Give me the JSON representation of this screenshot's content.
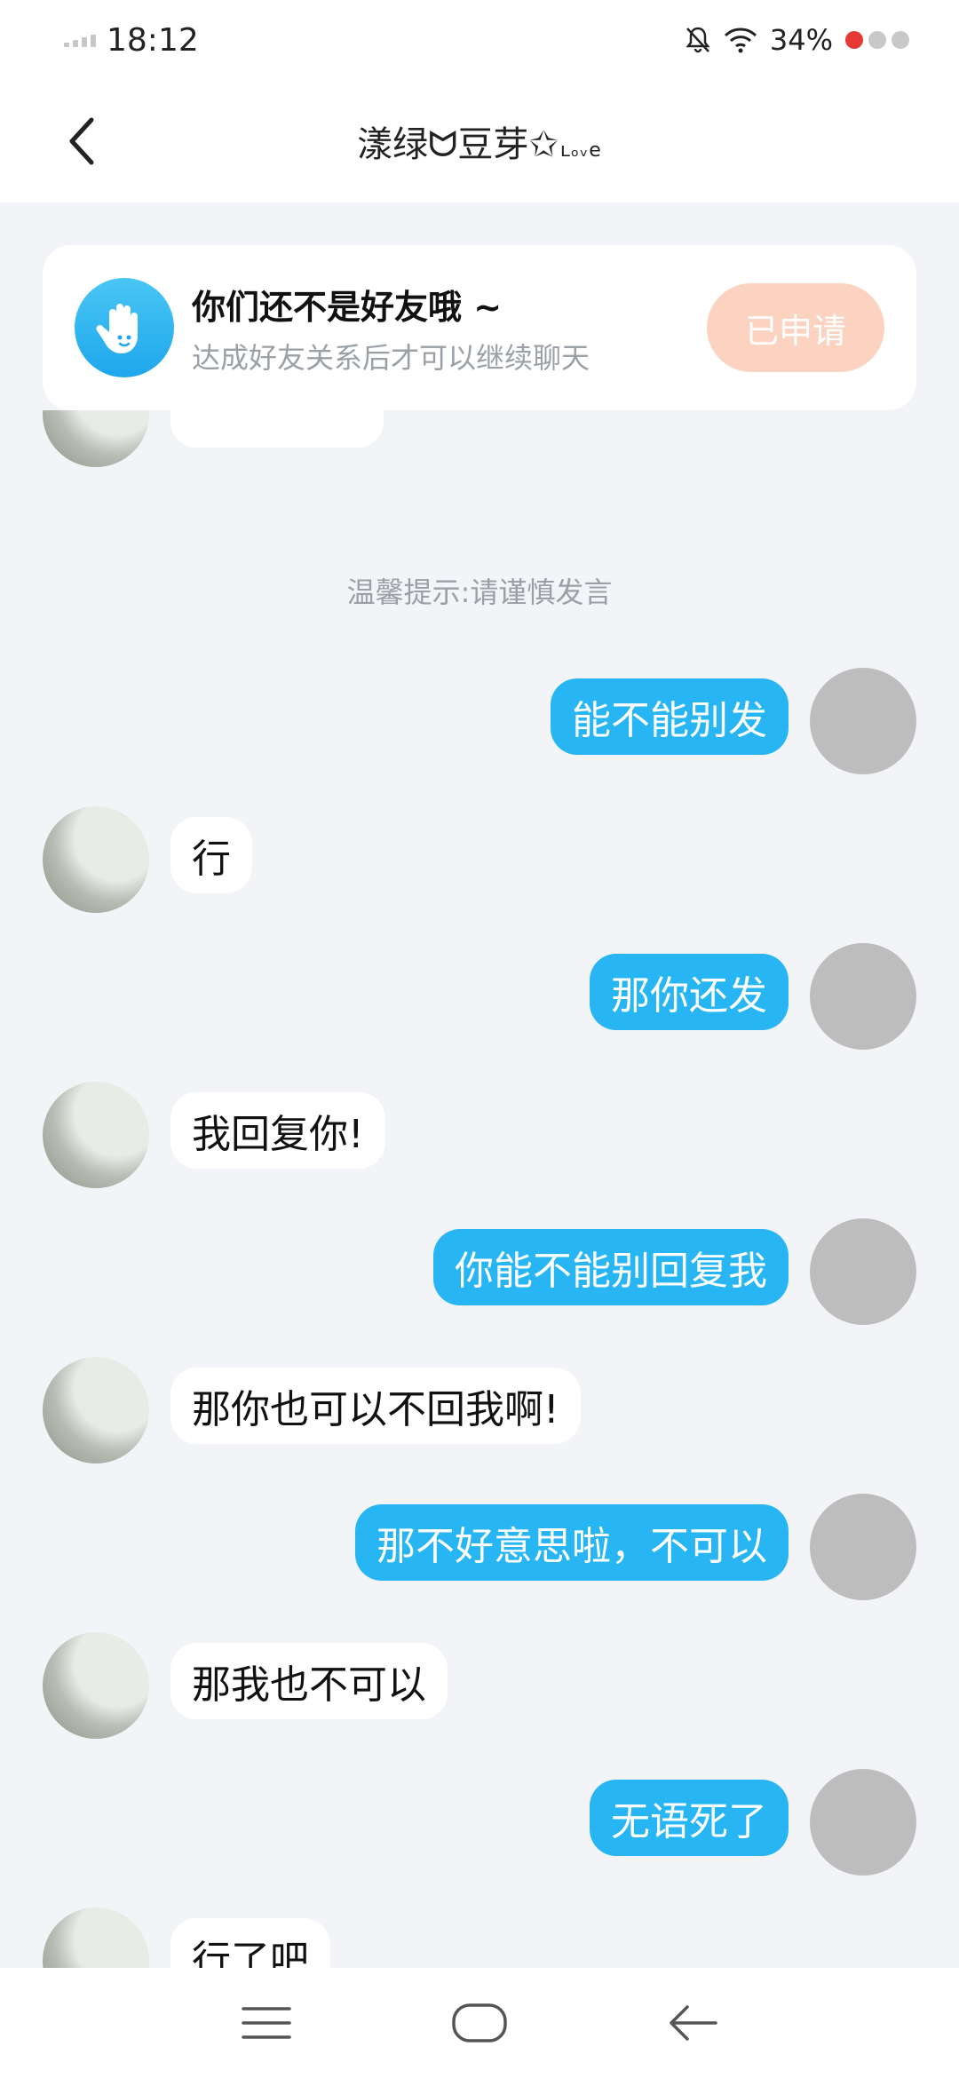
{
  "status_bar": {
    "time": "18:12",
    "battery": "34%"
  },
  "header": {
    "title": "漾绿ᗢ豆芽✩",
    "title_suffix": "ʟₒᵥe"
  },
  "notice": {
    "title": "你们还不是好友哦 ~",
    "subtitle": "达成好友关系后才可以继续聊天",
    "button_label": "已申请"
  },
  "chat": {
    "tip": "温馨提示:请谨慎发言",
    "messages": [
      {
        "from": "me",
        "text": "能不能别发"
      },
      {
        "from": "other",
        "text": "行"
      },
      {
        "from": "me",
        "text": "那你还发"
      },
      {
        "from": "other",
        "text": "我回复你!"
      },
      {
        "from": "me",
        "text": "你能不能别回复我"
      },
      {
        "from": "other",
        "text": "那你也可以不回我啊!"
      },
      {
        "from": "me",
        "text": "那不好意思啦，不可以"
      },
      {
        "from": "other",
        "text": "那我也不可以"
      },
      {
        "from": "me",
        "text": "无语死了"
      },
      {
        "from": "other",
        "text": "行了吧"
      }
    ]
  },
  "colors": {
    "accent": "#27b5f3",
    "applied_button": "#fcd3c0",
    "background": "#f2f4f7"
  },
  "icons": {
    "back": "chevron-left-icon",
    "notice": "hand-wave-icon",
    "menu": "menu-icon",
    "home": "home-icon",
    "nav_back": "arrow-left-icon"
  }
}
